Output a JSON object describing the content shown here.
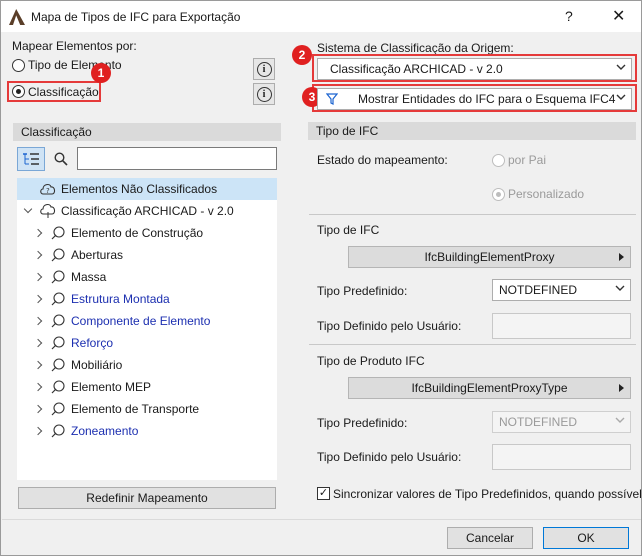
{
  "window": {
    "title": "Mapa de Tipos de IFC para Exportação",
    "help": "?",
    "close": "✕"
  },
  "mapping_by": {
    "label": "Mapear Elementos por:",
    "options": [
      "Tipo de Elemento",
      "Classificação"
    ],
    "selected": "Classificação",
    "info": "i"
  },
  "source_system": {
    "label": "Sistema de Classificação da Origem:",
    "value": "Classificação ARCHICAD - v 2.0",
    "filter_value": "Mostrar Entidades do IFC para o Esquema IFC4"
  },
  "badges": [
    "1",
    "2",
    "3"
  ],
  "tree": {
    "header": "Classificação",
    "search_value": "",
    "items": [
      {
        "label": "Elementos Não Classificados",
        "level": 0,
        "link": false
      },
      {
        "label": "Classificação ARCHICAD - v 2.0",
        "level": 0,
        "link": false
      },
      {
        "label": "Elemento de Construção",
        "level": 1,
        "link": false
      },
      {
        "label": "Aberturas",
        "level": 1,
        "link": false
      },
      {
        "label": "Massa",
        "level": 1,
        "link": false
      },
      {
        "label": "Estrutura Montada",
        "level": 1,
        "link": true
      },
      {
        "label": "Componente de Elemento",
        "level": 1,
        "link": true
      },
      {
        "label": "Reforço",
        "level": 1,
        "link": true
      },
      {
        "label": "Mobiliário",
        "level": 1,
        "link": false
      },
      {
        "label": "Elemento MEP",
        "level": 1,
        "link": false
      },
      {
        "label": "Elemento de Transporte",
        "level": 1,
        "link": false
      },
      {
        "label": "Zoneamento",
        "level": 1,
        "link": true
      }
    ],
    "reset_button": "Redefinir Mapeamento"
  },
  "ifc_type_panel": {
    "header": "Tipo de IFC",
    "mapping_state_label": "Estado do mapeamento:",
    "by_parent": "por Pai",
    "custom": "Personalizado",
    "ifc_type_label": "Tipo de IFC",
    "ifc_type_value": "IfcBuildingElementProxy",
    "predefined_label": "Tipo Predefinido:",
    "predefined_value": "NOTDEFINED",
    "user_defined_label": "Tipo Definido pelo Usuário:",
    "user_defined_value": "",
    "product_type_label": "Tipo de Produto IFC",
    "product_type_value": "IfcBuildingElementProxyType",
    "product_predefined_label": "Tipo Predefinido:",
    "product_predefined_value": "NOTDEFINED",
    "product_user_defined_label": "Tipo Definido pelo Usuário:",
    "product_user_defined_value": "",
    "sync_label": "Sincronizar valores de Tipo Predefinidos, quando possível",
    "sync_checked": true
  },
  "footer": {
    "cancel": "Cancelar",
    "ok": "OK"
  }
}
